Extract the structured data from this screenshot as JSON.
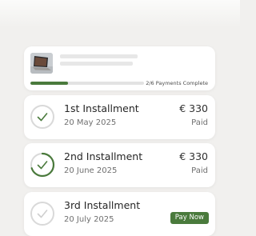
{
  "colors": {
    "accent": "#4a7a3c",
    "ring_track": "#d9d9d9",
    "card": "#ffffff",
    "background": "#f1f0ee"
  },
  "summary": {
    "product_image": "laptop-image",
    "progress_fraction": 0.3333,
    "progress_text": "2/6 Payments Complete"
  },
  "installments": [
    {
      "title": "1st Installment",
      "date": "20 May 2025",
      "amount": "€ 330",
      "status": "Paid",
      "ring_fraction": 0,
      "icon": "check-icon"
    },
    {
      "title": "2nd Installment",
      "date": "20 June 2025",
      "amount": "€ 330",
      "status": "Paid",
      "ring_fraction": 0.7,
      "icon": "check-icon"
    },
    {
      "title": "3rd Installment",
      "date": "20 July 2025",
      "action_label": "Pay Now",
      "ring_fraction": 0,
      "icon": "check-icon"
    }
  ]
}
